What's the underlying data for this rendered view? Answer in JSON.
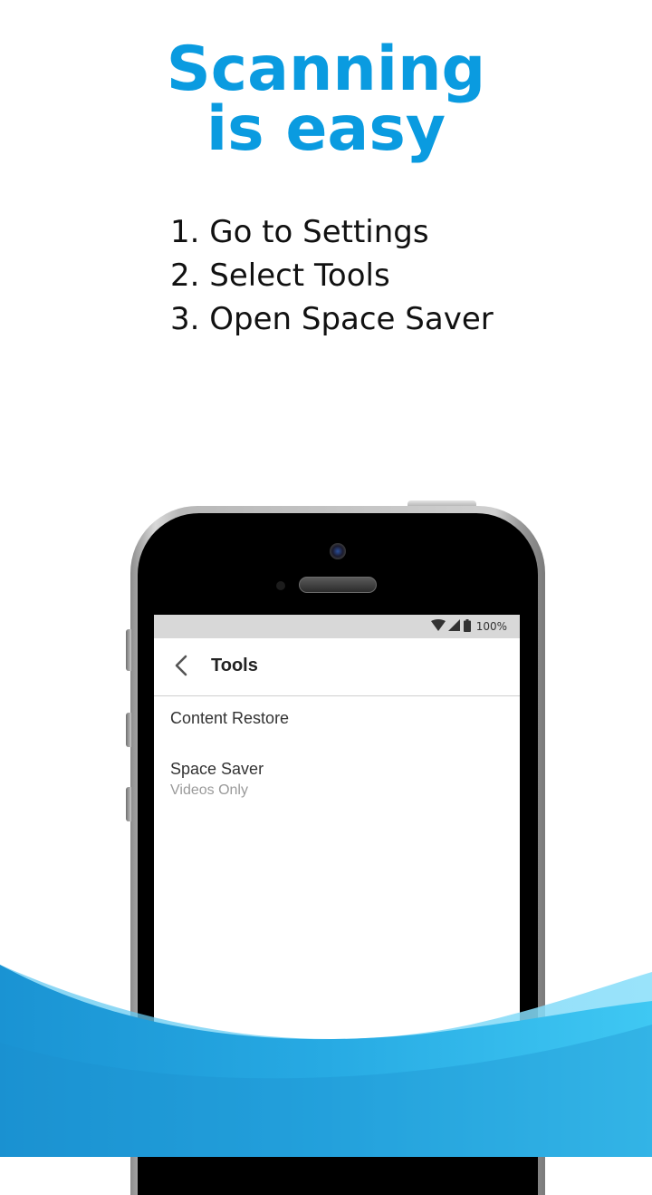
{
  "headline": {
    "line1": "Scanning",
    "line2": "is easy"
  },
  "steps": [
    "1. Go to Settings",
    "2. Select Tools",
    "3. Open Space Saver"
  ],
  "phone_screen": {
    "status_bar": {
      "battery_text": "100%",
      "icons": [
        "wifi-icon",
        "signal-icon",
        "battery-icon"
      ]
    },
    "app_bar": {
      "title": "Tools",
      "back_icon": "chevron-left-icon"
    },
    "items": [
      {
        "label": "Content Restore"
      },
      {
        "label": "Space Saver",
        "subtitle": "Videos Only"
      }
    ]
  },
  "colors": {
    "accent": "#0a9be0",
    "wave_dark": "#1f9bd8",
    "wave_light": "#3cc6f2"
  }
}
